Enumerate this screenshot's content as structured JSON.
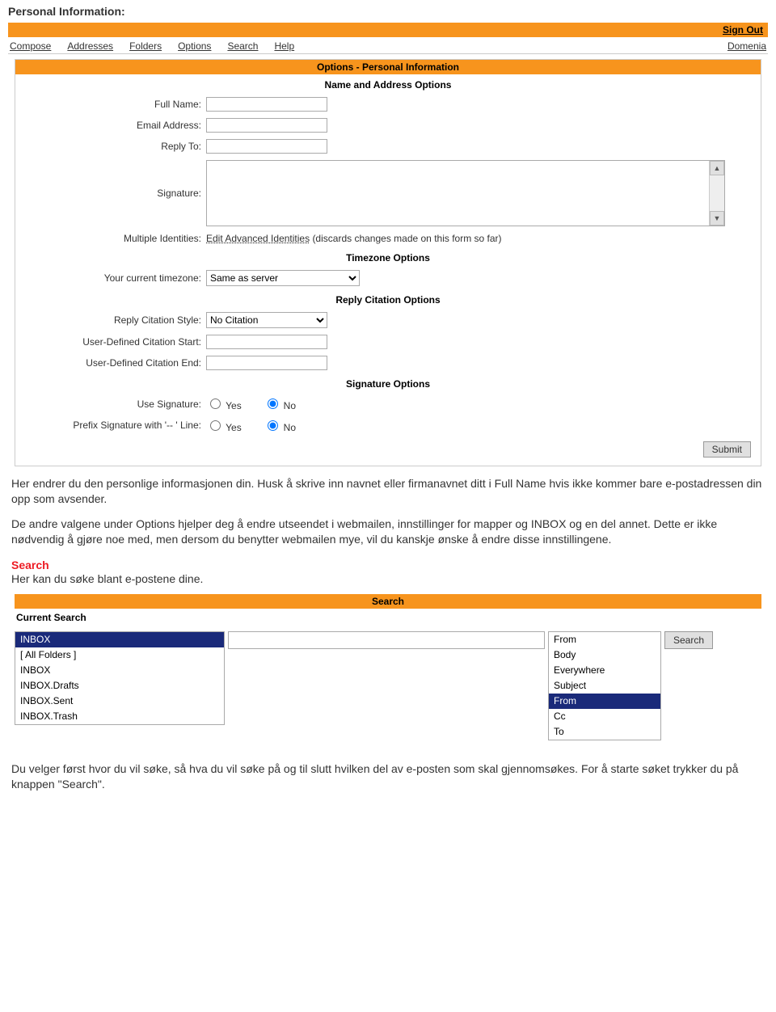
{
  "heading": "Personal Information:",
  "top_bar": {
    "sign_out": "Sign Out"
  },
  "nav": {
    "items": [
      "Compose",
      "Addresses",
      "Folders",
      "Options",
      "Search",
      "Help"
    ],
    "right": "Domenia"
  },
  "options_panel": {
    "title": "Options - Personal Information",
    "name_addr_title": "Name and Address Options",
    "fields": {
      "full_name": "Full Name:",
      "email_address": "Email Address:",
      "reply_to": "Reply To:",
      "signature": "Signature:",
      "multiple_identities_label": "Multiple Identities:",
      "edit_advanced": "Edit Advanced Identities",
      "discards_note": "(discards changes made on this form so far)"
    },
    "timezone_title": "Timezone Options",
    "timezone_label": "Your current timezone:",
    "timezone_value": "Same as server",
    "reply_citation_title": "Reply Citation Options",
    "reply_style_label": "Reply Citation Style:",
    "reply_style_value": "No Citation",
    "user_start_label": "User-Defined Citation Start:",
    "user_end_label": "User-Defined Citation End:",
    "signature_options_title": "Signature Options",
    "use_signature_label": "Use Signature:",
    "prefix_label": "Prefix Signature with '-- ' Line:",
    "yes": "Yes",
    "no": "No",
    "submit": "Submit"
  },
  "paragraphs": {
    "p1": "Her endrer du den personlige informasjonen din. Husk å skrive inn navnet eller firmanavnet ditt i Full Name hvis ikke kommer bare e-postadressen din opp som avsender.",
    "p2": "De andre valgene under Options hjelper deg å endre utseendet i webmailen, innstillinger for mapper og INBOX og en del annet. Dette er ikke nødvendig å gjøre noe med, men dersom du benytter webmailen mye, vil du kanskje ønske å endre disse innstillingene.",
    "search_heading": "Search",
    "search_intro": "Her kan du søke blant e-postene dine.",
    "p3": "Du velger først hvor du vil søke, så hva du vil søke på og til slutt hvilken del av e-posten som skal gjennomsøkes. For å starte søket trykker du på knappen \"Search\"."
  },
  "search_panel": {
    "title": "Search",
    "current_label": "Current Search",
    "folders": [
      "INBOX",
      "[ All Folders ]",
      "INBOX",
      "INBOX.Drafts",
      "INBOX.Sent",
      "INBOX.Trash"
    ],
    "folder_selected_index": 0,
    "fields": [
      "From",
      "Body",
      "Everywhere",
      "Subject",
      "From",
      "Cc",
      "To"
    ],
    "field_selected_index": 4,
    "search_button": "Search"
  }
}
